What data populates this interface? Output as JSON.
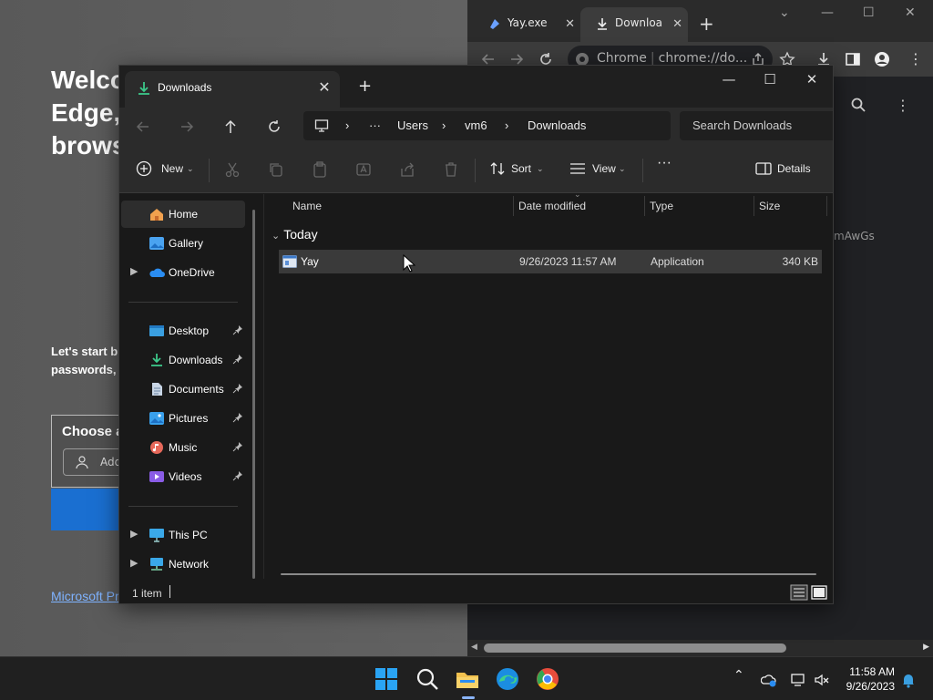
{
  "edge": {
    "welcome": "Welco\nEdge,\nbrows",
    "sub": "Let's start b\npasswords,",
    "choose": "Choose a",
    "add": "Add",
    "link": "Microsoft Pr"
  },
  "chrome": {
    "tab1": "Yay.exe",
    "tab2": "Downloa",
    "omni_label": "Chrome",
    "omni_url": "chrome://do...",
    "fragment": "mAwGs"
  },
  "explorer": {
    "tab_title": "Downloads",
    "breadcrumb": [
      "Users",
      "vm6",
      "Downloads"
    ],
    "search_placeholder": "Search Downloads",
    "toolbar": {
      "new": "New",
      "sort": "Sort",
      "view": "View",
      "details": "Details"
    },
    "sidebar": [
      {
        "label": "Home",
        "icon": "home-icon"
      },
      {
        "label": "Gallery",
        "icon": "gallery-icon"
      },
      {
        "label": "OneDrive",
        "icon": "onedrive-icon"
      },
      {
        "label": "Desktop",
        "icon": "desktop-icon"
      },
      {
        "label": "Downloads",
        "icon": "downloads-icon"
      },
      {
        "label": "Documents",
        "icon": "documents-icon"
      },
      {
        "label": "Pictures",
        "icon": "pictures-icon"
      },
      {
        "label": "Music",
        "icon": "music-icon"
      },
      {
        "label": "Videos",
        "icon": "videos-icon"
      },
      {
        "label": "This PC",
        "icon": "this-pc-icon"
      },
      {
        "label": "Network",
        "icon": "network-icon"
      }
    ],
    "columns": [
      "Name",
      "Date modified",
      "Type",
      "Size"
    ],
    "group": "Today",
    "files": [
      {
        "name": "Yay",
        "date": "9/26/2023 11:57 AM",
        "type": "Application",
        "size": "340 KB"
      }
    ],
    "status": "1 item"
  },
  "taskbar": {
    "time": "11:58 AM",
    "date": "9/26/2023"
  },
  "colors": {
    "accent": "#1a6fd1",
    "folder": "#f2c14e",
    "download_green": "#3cc88a"
  }
}
